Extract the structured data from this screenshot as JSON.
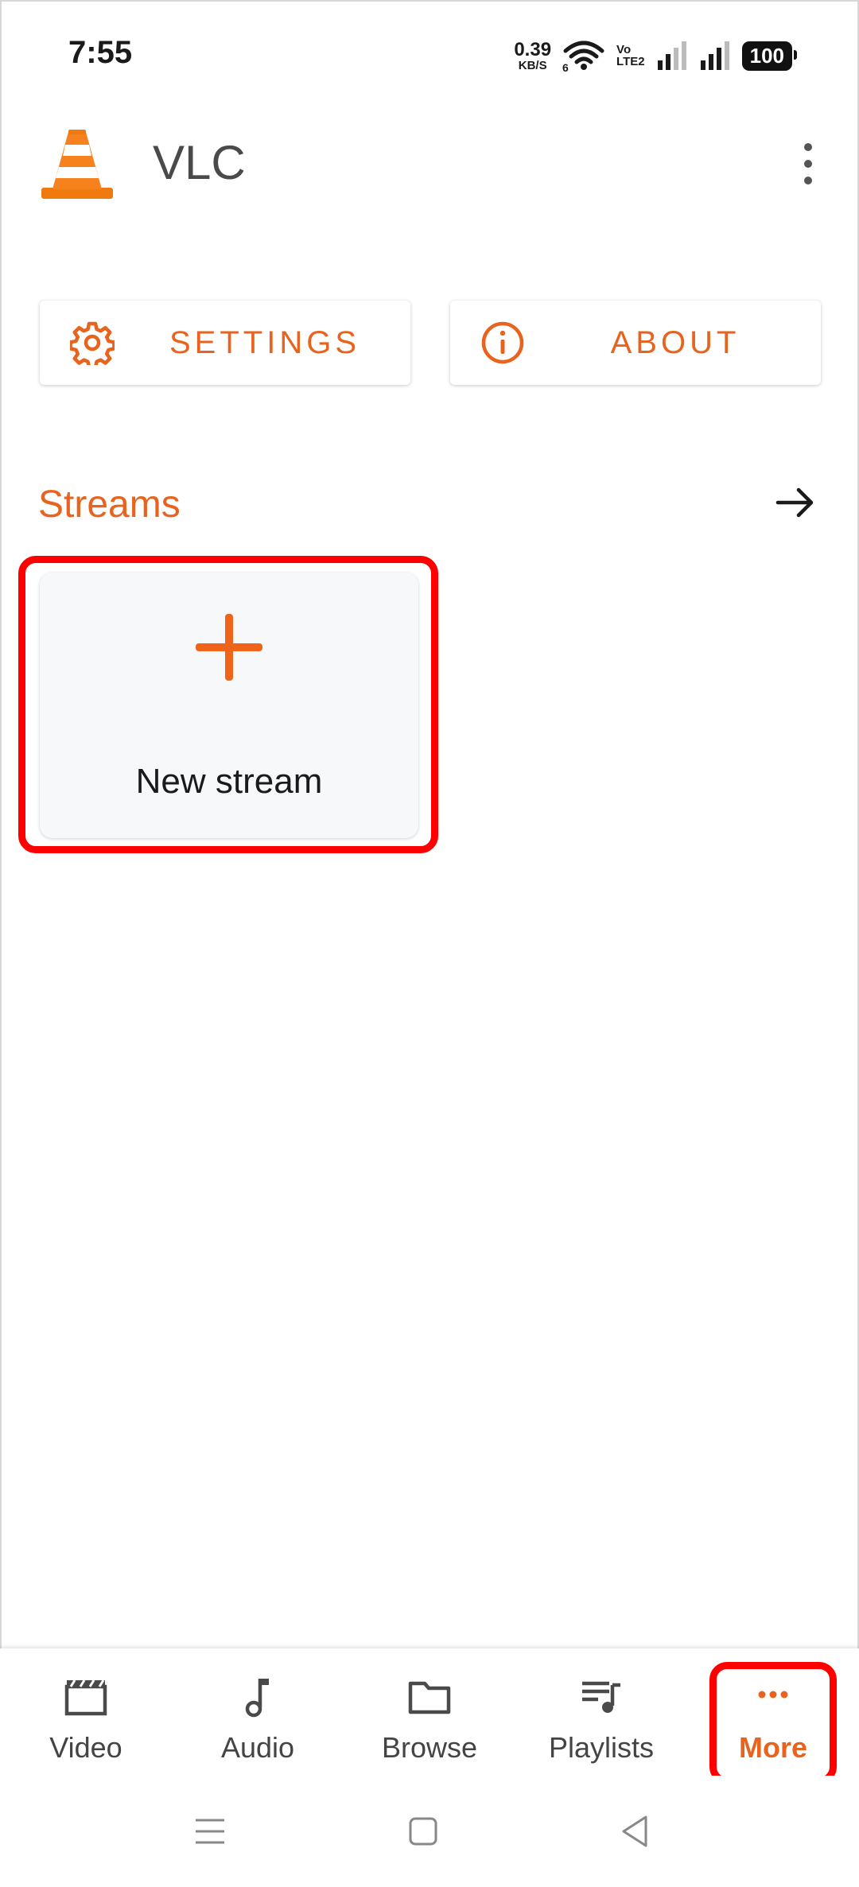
{
  "status_bar": {
    "time": "7:55",
    "net_speed_value": "0.39",
    "net_speed_unit": "KB/S",
    "wifi_label": "6",
    "volte_top": "Vo",
    "volte_bottom": "LTE2",
    "battery": "100"
  },
  "app_bar": {
    "title": "VLC",
    "logo_icon": "vlc-cone-icon",
    "menu_icon": "overflow-menu-icon"
  },
  "top_buttons": {
    "settings_label": "SETTINGS",
    "settings_icon": "gear-icon",
    "about_label": "ABOUT",
    "about_icon": "info-icon"
  },
  "streams": {
    "title": "Streams",
    "arrow_icon": "arrow-right-icon",
    "new_stream_label": "New stream",
    "new_stream_icon": "plus-icon"
  },
  "bottom_nav": {
    "items": [
      {
        "label": "Video",
        "icon": "video-clapper-icon",
        "active": false
      },
      {
        "label": "Audio",
        "icon": "music-note-icon",
        "active": false
      },
      {
        "label": "Browse",
        "icon": "folder-icon",
        "active": false
      },
      {
        "label": "Playlists",
        "icon": "playlist-icon",
        "active": false
      },
      {
        "label": "More",
        "icon": "more-dots-icon",
        "active": true
      }
    ]
  },
  "colors": {
    "accent": "#e8641e",
    "highlight": "#ff0000",
    "text": "#222222"
  }
}
